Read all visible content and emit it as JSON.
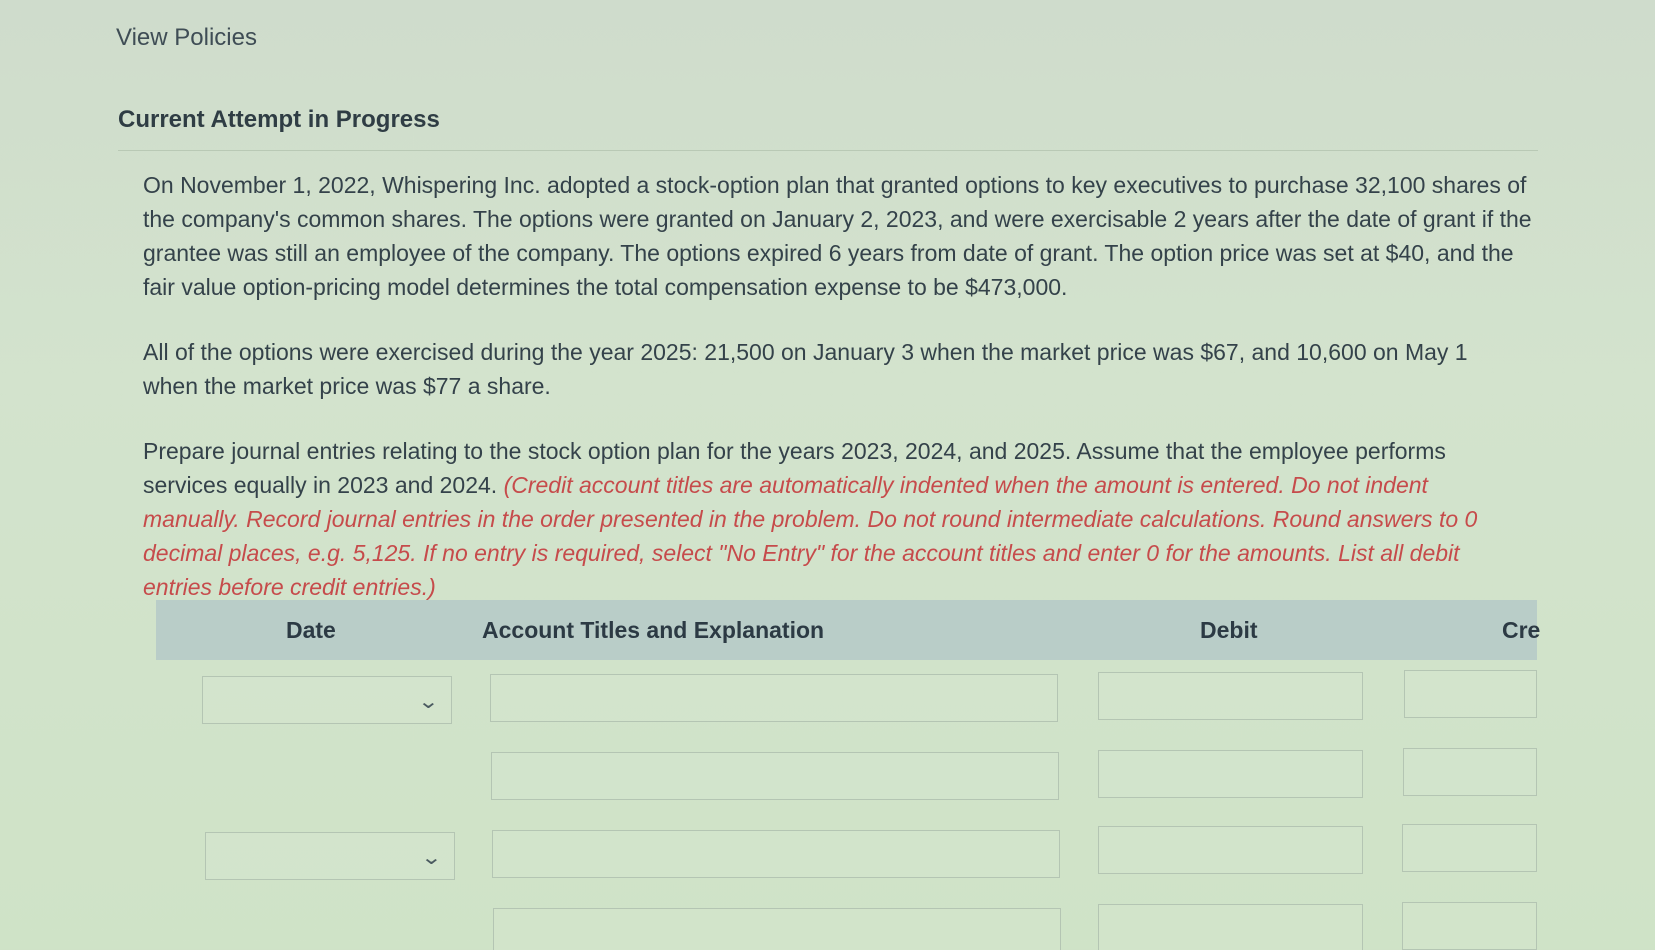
{
  "nav": {
    "view_policies": "View Policies"
  },
  "heading": "Current Attempt in Progress",
  "problem": {
    "paragraph1": "On November 1, 2022, Whispering Inc. adopted a stock-option plan that granted options to key executives to purchase 32,100 shares of the company's common shares. The options were granted on January 2, 2023, and were exercisable 2 years after the date of grant if the grantee was still an employee of the company. The options expired 6 years from date of grant. The option price was set at $40, and the fair value option-pricing model determines the total compensation expense to be $473,000.",
    "paragraph2": "All of the options were exercised during the year 2025: 21,500 on January 3 when the market price was $67, and 10,600 on May 1 when the market price was $77 a share.",
    "paragraph3_plain": "Prepare journal entries relating to the stock option plan for the years 2023, 2024, and 2025. Assume that the employee performs services equally in 2023 and 2024. ",
    "paragraph3_instructions": "(Credit account titles are automatically indented when the amount is entered. Do not indent manually. Record journal entries in the order presented in the problem. Do not round intermediate calculations. Round answers to 0 decimal places, e.g. 5,125. If no entry is required, select \"No Entry\" for the account titles and enter 0 for the amounts. List all debit entries before credit entries.)"
  },
  "table": {
    "headers": {
      "date": "Date",
      "account": "Account Titles and Explanation",
      "debit": "Debit",
      "credit": "Cre"
    },
    "rows": [
      {
        "date": "",
        "account": "",
        "debit": "",
        "credit": ""
      },
      {
        "date": null,
        "account": "",
        "debit": "",
        "credit": ""
      },
      {
        "date": "",
        "account": "",
        "debit": "",
        "credit": ""
      },
      {
        "date": null,
        "account": "",
        "debit": "",
        "credit": ""
      }
    ]
  },
  "icons": {
    "dropdown": "chevron-down-icon"
  },
  "colors": {
    "instruction_red": "#c64b4b",
    "header_bg": "#b9cdc8"
  }
}
